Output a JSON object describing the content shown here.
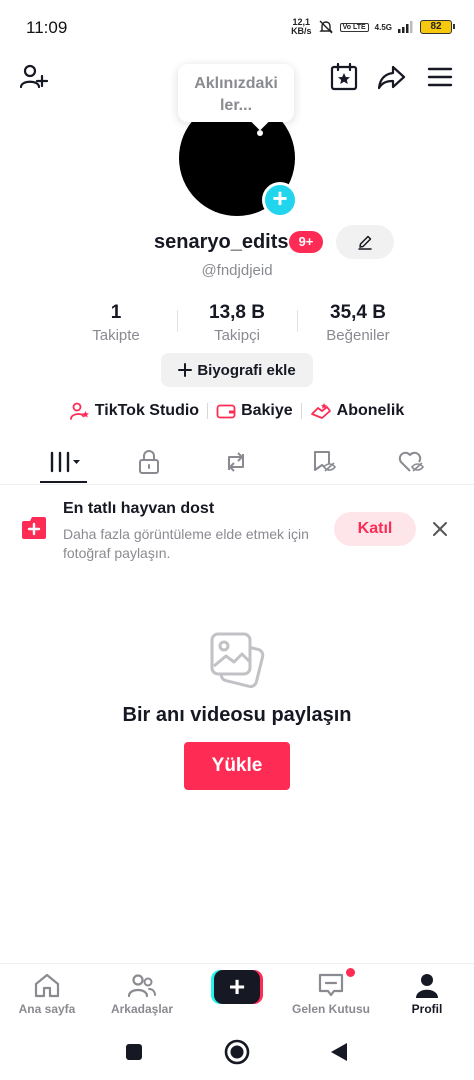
{
  "status_bar": {
    "time": "11:09",
    "speed_value": "12,1",
    "speed_unit": "KB/s",
    "volte": "Vo LTE",
    "network": "4.5G",
    "battery": "82"
  },
  "profile": {
    "bubble_text": "Aklınızdakiler...",
    "username": "senaryo_edits",
    "notif_badge": "9+",
    "handle": "@fndjdjeid",
    "stats": [
      {
        "value": "1",
        "label": "Takipte"
      },
      {
        "value": "13,8 B",
        "label": "Takipçi"
      },
      {
        "value": "35,4 B",
        "label": "Beğeniler"
      }
    ],
    "bio_button": "Biyografi ekle",
    "links": [
      "TikTok Studio",
      "Bakiye",
      "Abonelik"
    ]
  },
  "banner": {
    "title": "En tatlı hayvan dost",
    "description": "Daha fazla görüntüleme elde etmek için fotoğraf paylaşın.",
    "join_label": "Katıl"
  },
  "empty_state": {
    "title": "Bir anı videosu paylaşın",
    "upload_label": "Yükle"
  },
  "bottom_nav": {
    "items": [
      "Ana sayfa",
      "Arkadaşlar",
      "Gelen Kutusu",
      "Profil"
    ]
  },
  "colors": {
    "accent": "#fe2c55",
    "cyan": "#25f4ee",
    "text": "#161823",
    "muted": "#8a8b91"
  }
}
